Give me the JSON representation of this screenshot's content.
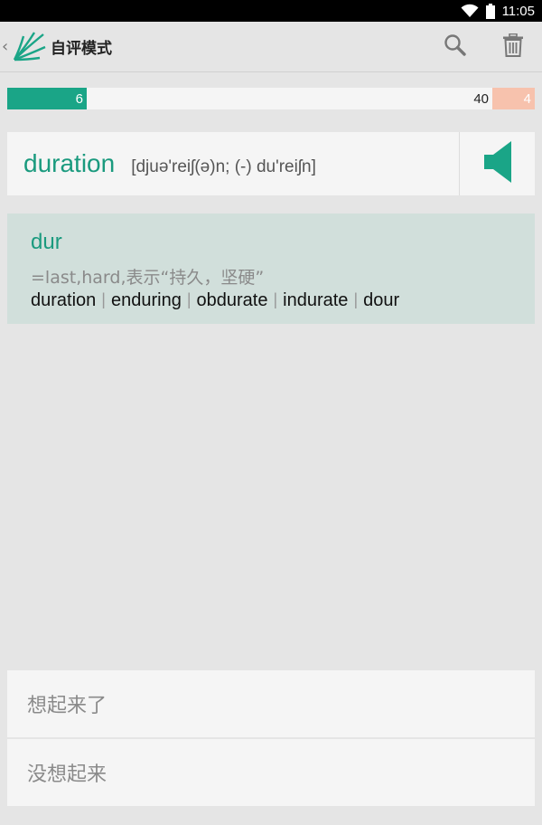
{
  "status_bar": {
    "time": "11:05"
  },
  "app_bar": {
    "title": "自评模式",
    "back_glyph": "‹",
    "icons": [
      "chevron-left-icon",
      "leaf-logo-icon",
      "search-icon",
      "trash-icon"
    ]
  },
  "progress": {
    "known": "6",
    "total": "40",
    "unknown": "4",
    "known_fraction": 0.15,
    "unknown_fraction": 0.08,
    "colors": {
      "known": "#1aa587",
      "unknown": "#f7c2ad",
      "track": "#f5f5f5"
    }
  },
  "word": {
    "text": "duration",
    "phonetic": "[djuə'reiʃ(ə)n; (-) du'reiʃn]",
    "speaker_icon": "speaker-icon"
  },
  "root": {
    "name": "dur",
    "meaning": "=last,hard,表示“持久，坚硬”",
    "examples": [
      "duration",
      "enduring",
      "obdurate",
      "indurate",
      "dour"
    ],
    "separator": "|"
  },
  "answers": {
    "remember": "想起来了",
    "forgot": "没想起来"
  },
  "colors": {
    "accent": "#1a9a7e",
    "background": "#e5e5e5",
    "card": "#f5f5f5",
    "root_card": "#d1dfdb"
  }
}
